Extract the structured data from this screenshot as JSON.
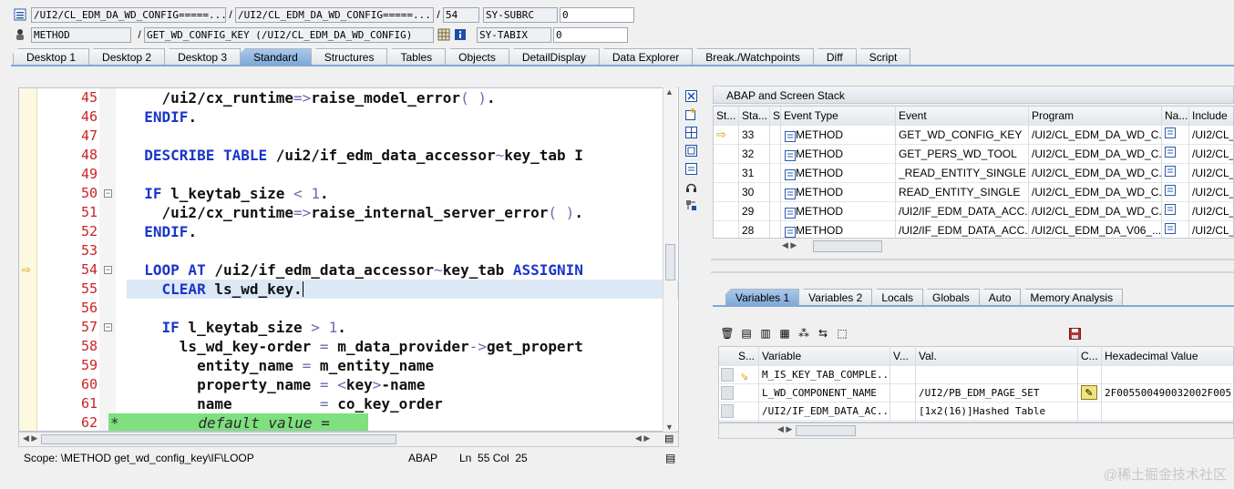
{
  "header": {
    "row1": {
      "icon": "list-icon",
      "field1": "/UI2/CL_EDM_DA_WD_CONFIG=====...",
      "field2": "/UI2/CL_EDM_DA_WD_CONFIG=====...",
      "line": "54",
      "var_name": "SY-SUBRC",
      "var_value": "0"
    },
    "row2": {
      "icon": "person-icon",
      "type": "METHOD",
      "name": "GET_WD_CONFIG_KEY (/UI2/CL_EDM_DA_WD_CONFIG)",
      "var_name": "SY-TABIX",
      "var_value": "0"
    }
  },
  "tabs": [
    "Desktop 1",
    "Desktop 2",
    "Desktop 3",
    "Standard",
    "Structures",
    "Tables",
    "Objects",
    "DetailDisplay",
    "Data Explorer",
    "Break./Watchpoints",
    "Diff",
    "Script"
  ],
  "active_tab": "Standard",
  "editor": {
    "lines": [
      {
        "num": "45",
        "text": "    /ui2/cx_runtime=>raise_model_error( )."
      },
      {
        "num": "46",
        "text": "  ENDIF."
      },
      {
        "num": "47",
        "text": ""
      },
      {
        "num": "48",
        "text": "  DESCRIBE TABLE /ui2/if_edm_data_accessor~key_tab I"
      },
      {
        "num": "49",
        "text": ""
      },
      {
        "num": "50",
        "text": "  IF l_keytab_size < 1."
      },
      {
        "num": "51",
        "text": "    /ui2/cx_runtime=>raise_internal_server_error( )."
      },
      {
        "num": "52",
        "text": "  ENDIF."
      },
      {
        "num": "53",
        "text": ""
      },
      {
        "num": "54",
        "text": "  LOOP AT /ui2/if_edm_data_accessor~key_tab ASSIGNIN"
      },
      {
        "num": "55",
        "text": "    CLEAR ls_wd_key."
      },
      {
        "num": "56",
        "text": ""
      },
      {
        "num": "57",
        "text": "    IF l_keytab_size > 1."
      },
      {
        "num": "58",
        "text": "      ls_wd_key-order = m_data_provider->get_propert"
      },
      {
        "num": "59",
        "text": "        entity_name = m_entity_name"
      },
      {
        "num": "60",
        "text": "        property_name = <key>-name"
      },
      {
        "num": "61",
        "text": "        name          = co_key_order"
      },
      {
        "num": "62",
        "text": "*         default value ="
      }
    ],
    "current_line": "54",
    "cursor_line": "55"
  },
  "status": {
    "scope": "Scope: \\METHOD get_wd_config_key\\IF\\LOOP",
    "lang": "ABAP",
    "position": "Ln  55 Col  25"
  },
  "stack": {
    "title": "ABAP and Screen Stack",
    "columns": [
      "St...",
      "Sta...",
      "S...",
      "Event Type",
      "Event",
      "Program",
      "Na...",
      "Include"
    ],
    "rows": [
      {
        "level": "33",
        "type": "METHOD",
        "event": "GET_WD_CONFIG_KEY",
        "program": "/UI2/CL_EDM_DA_WD_C...",
        "include": "/UI2/CL_"
      },
      {
        "level": "32",
        "type": "METHOD",
        "event": "GET_PERS_WD_TOOL",
        "program": "/UI2/CL_EDM_DA_WD_C...",
        "include": "/UI2/CL_"
      },
      {
        "level": "31",
        "type": "METHOD",
        "event": "_READ_ENTITY_SINGLE",
        "program": "/UI2/CL_EDM_DA_WD_C...",
        "include": "/UI2/CL_"
      },
      {
        "level": "30",
        "type": "METHOD",
        "event": "READ_ENTITY_SINGLE",
        "program": "/UI2/CL_EDM_DA_WD_C...",
        "include": "/UI2/CL_"
      },
      {
        "level": "29",
        "type": "METHOD",
        "event": "/UI2/IF_EDM_DATA_ACC...",
        "program": "/UI2/CL_EDM_DA_WD_C...",
        "include": "/UI2/CL_"
      },
      {
        "level": "28",
        "type": "METHOD",
        "event": "/UI2/IF_EDM_DATA_ACC...",
        "program": "/UI2/CL_EDM_DA_V06_...",
        "include": "/UI2/CL_"
      }
    ]
  },
  "var_tabs": [
    "Variables 1",
    "Variables 2",
    "Locals",
    "Globals",
    "Auto",
    "Memory Analysis"
  ],
  "active_var_tab": "Variables 1",
  "variables": {
    "columns": [
      "S...",
      "Variable",
      "V...",
      "Val.",
      "C...",
      "Hexadecimal Value"
    ],
    "rows": [
      {
        "name": "M_IS_KEY_TAB_COMPLE...",
        "value": "",
        "hex": ""
      },
      {
        "name": "L_WD_COMPONENT_NAME",
        "value": "/UI2/PB_EDM_PAGE_SET",
        "hex": "2F005500490032002F005"
      },
      {
        "name": "/UI2/IF_EDM_DATA_AC...",
        "value": "[1x2(16)]Hashed Table",
        "hex": ""
      }
    ]
  },
  "watermark": "@稀土掘金技术社区"
}
